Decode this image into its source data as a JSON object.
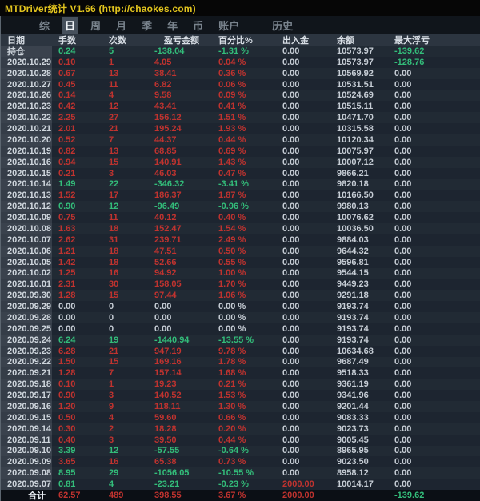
{
  "window": {
    "title": "MTDriver统计 V1.66 (http://chaokes.com)"
  },
  "tabs": [
    {
      "id": "zong",
      "label": "综",
      "active": false,
      "gap": false
    },
    {
      "id": "ri",
      "label": "日",
      "active": true,
      "gap": false
    },
    {
      "id": "zhou",
      "label": "周",
      "active": false,
      "gap": false
    },
    {
      "id": "yue",
      "label": "月",
      "active": false,
      "gap": false
    },
    {
      "id": "ji",
      "label": "季",
      "active": false,
      "gap": false
    },
    {
      "id": "nian",
      "label": "年",
      "active": false,
      "gap": false
    },
    {
      "id": "bi",
      "label": "币",
      "active": false,
      "gap": false
    },
    {
      "id": "zhanghu",
      "label": "账户",
      "active": false,
      "gap": false
    },
    {
      "id": "lishi",
      "label": "历史",
      "active": false,
      "gap": true
    }
  ],
  "colors": {
    "title_yellow": "#e2c41e",
    "profit_red": "#c0332f",
    "loss_green": "#33bd7a",
    "neutral_gray": "#c6cdd5",
    "date_column_bg": "#3a424d",
    "table_bg": "#1f2731"
  },
  "table": {
    "headers": [
      "日期",
      "手数",
      "次数",
      "盈亏金额",
      "百分比%",
      "出入金",
      "余额",
      "最大浮亏"
    ],
    "rows": [
      {
        "date": "持仓",
        "lots": "0.24",
        "trades": "5",
        "pnl": "-138.04",
        "pct": "-1.31 %",
        "cash": "0.00",
        "balance": "10573.97",
        "maxdd": "-139.62",
        "tone": "green",
        "cash_tone": "neutral",
        "maxdd_tone": "green",
        "total": false
      },
      {
        "date": "2020.10.29",
        "lots": "0.10",
        "trades": "1",
        "pnl": "4.05",
        "pct": "0.04 %",
        "cash": "0.00",
        "balance": "10573.97",
        "maxdd": "-128.76",
        "tone": "red",
        "cash_tone": "neutral",
        "maxdd_tone": "green",
        "total": false
      },
      {
        "date": "2020.10.28",
        "lots": "0.67",
        "trades": "13",
        "pnl": "38.41",
        "pct": "0.36 %",
        "cash": "0.00",
        "balance": "10569.92",
        "maxdd": "0.00",
        "tone": "red",
        "cash_tone": "neutral",
        "maxdd_tone": "neutral",
        "total": false
      },
      {
        "date": "2020.10.27",
        "lots": "0.45",
        "trades": "11",
        "pnl": "6.82",
        "pct": "0.06 %",
        "cash": "0.00",
        "balance": "10531.51",
        "maxdd": "0.00",
        "tone": "red",
        "cash_tone": "neutral",
        "maxdd_tone": "neutral",
        "total": false
      },
      {
        "date": "2020.10.26",
        "lots": "0.14",
        "trades": "4",
        "pnl": "9.58",
        "pct": "0.09 %",
        "cash": "0.00",
        "balance": "10524.69",
        "maxdd": "0.00",
        "tone": "red",
        "cash_tone": "neutral",
        "maxdd_tone": "neutral",
        "total": false
      },
      {
        "date": "2020.10.23",
        "lots": "0.42",
        "trades": "12",
        "pnl": "43.41",
        "pct": "0.41 %",
        "cash": "0.00",
        "balance": "10515.11",
        "maxdd": "0.00",
        "tone": "red",
        "cash_tone": "neutral",
        "maxdd_tone": "neutral",
        "total": false
      },
      {
        "date": "2020.10.22",
        "lots": "2.25",
        "trades": "27",
        "pnl": "156.12",
        "pct": "1.51 %",
        "cash": "0.00",
        "balance": "10471.70",
        "maxdd": "0.00",
        "tone": "red",
        "cash_tone": "neutral",
        "maxdd_tone": "neutral",
        "total": false
      },
      {
        "date": "2020.10.21",
        "lots": "2.01",
        "trades": "21",
        "pnl": "195.24",
        "pct": "1.93 %",
        "cash": "0.00",
        "balance": "10315.58",
        "maxdd": "0.00",
        "tone": "red",
        "cash_tone": "neutral",
        "maxdd_tone": "neutral",
        "total": false
      },
      {
        "date": "2020.10.20",
        "lots": "0.52",
        "trades": "7",
        "pnl": "44.37",
        "pct": "0.44 %",
        "cash": "0.00",
        "balance": "10120.34",
        "maxdd": "0.00",
        "tone": "red",
        "cash_tone": "neutral",
        "maxdd_tone": "neutral",
        "total": false
      },
      {
        "date": "2020.10.19",
        "lots": "0.82",
        "trades": "13",
        "pnl": "68.85",
        "pct": "0.69 %",
        "cash": "0.00",
        "balance": "10075.97",
        "maxdd": "0.00",
        "tone": "red",
        "cash_tone": "neutral",
        "maxdd_tone": "neutral",
        "total": false
      },
      {
        "date": "2020.10.16",
        "lots": "0.94",
        "trades": "15",
        "pnl": "140.91",
        "pct": "1.43 %",
        "cash": "0.00",
        "balance": "10007.12",
        "maxdd": "0.00",
        "tone": "red",
        "cash_tone": "neutral",
        "maxdd_tone": "neutral",
        "total": false
      },
      {
        "date": "2020.10.15",
        "lots": "0.21",
        "trades": "3",
        "pnl": "46.03",
        "pct": "0.47 %",
        "cash": "0.00",
        "balance": "9866.21",
        "maxdd": "0.00",
        "tone": "red",
        "cash_tone": "neutral",
        "maxdd_tone": "neutral",
        "total": false
      },
      {
        "date": "2020.10.14",
        "lots": "1.49",
        "trades": "22",
        "pnl": "-346.32",
        "pct": "-3.41 %",
        "cash": "0.00",
        "balance": "9820.18",
        "maxdd": "0.00",
        "tone": "green",
        "cash_tone": "neutral",
        "maxdd_tone": "neutral",
        "total": false
      },
      {
        "date": "2020.10.13",
        "lots": "1.52",
        "trades": "17",
        "pnl": "186.37",
        "pct": "1.87 %",
        "cash": "0.00",
        "balance": "10166.50",
        "maxdd": "0.00",
        "tone": "red",
        "cash_tone": "neutral",
        "maxdd_tone": "neutral",
        "total": false
      },
      {
        "date": "2020.10.12",
        "lots": "0.90",
        "trades": "12",
        "pnl": "-96.49",
        "pct": "-0.96 %",
        "cash": "0.00",
        "balance": "9980.13",
        "maxdd": "0.00",
        "tone": "green",
        "cash_tone": "neutral",
        "maxdd_tone": "neutral",
        "total": false
      },
      {
        "date": "2020.10.09",
        "lots": "0.75",
        "trades": "11",
        "pnl": "40.12",
        "pct": "0.40 %",
        "cash": "0.00",
        "balance": "10076.62",
        "maxdd": "0.00",
        "tone": "red",
        "cash_tone": "neutral",
        "maxdd_tone": "neutral",
        "total": false
      },
      {
        "date": "2020.10.08",
        "lots": "1.63",
        "trades": "18",
        "pnl": "152.47",
        "pct": "1.54 %",
        "cash": "0.00",
        "balance": "10036.50",
        "maxdd": "0.00",
        "tone": "red",
        "cash_tone": "neutral",
        "maxdd_tone": "neutral",
        "total": false
      },
      {
        "date": "2020.10.07",
        "lots": "2.62",
        "trades": "31",
        "pnl": "239.71",
        "pct": "2.49 %",
        "cash": "0.00",
        "balance": "9884.03",
        "maxdd": "0.00",
        "tone": "red",
        "cash_tone": "neutral",
        "maxdd_tone": "neutral",
        "total": false
      },
      {
        "date": "2020.10.06",
        "lots": "1.21",
        "trades": "18",
        "pnl": "47.51",
        "pct": "0.50 %",
        "cash": "0.00",
        "balance": "9644.32",
        "maxdd": "0.00",
        "tone": "red",
        "cash_tone": "neutral",
        "maxdd_tone": "neutral",
        "total": false
      },
      {
        "date": "2020.10.05",
        "lots": "1.42",
        "trades": "18",
        "pnl": "52.66",
        "pct": "0.55 %",
        "cash": "0.00",
        "balance": "9596.81",
        "maxdd": "0.00",
        "tone": "red",
        "cash_tone": "neutral",
        "maxdd_tone": "neutral",
        "total": false
      },
      {
        "date": "2020.10.02",
        "lots": "1.25",
        "trades": "16",
        "pnl": "94.92",
        "pct": "1.00 %",
        "cash": "0.00",
        "balance": "9544.15",
        "maxdd": "0.00",
        "tone": "red",
        "cash_tone": "neutral",
        "maxdd_tone": "neutral",
        "total": false
      },
      {
        "date": "2020.10.01",
        "lots": "2.31",
        "trades": "30",
        "pnl": "158.05",
        "pct": "1.70 %",
        "cash": "0.00",
        "balance": "9449.23",
        "maxdd": "0.00",
        "tone": "red",
        "cash_tone": "neutral",
        "maxdd_tone": "neutral",
        "total": false
      },
      {
        "date": "2020.09.30",
        "lots": "1.28",
        "trades": "15",
        "pnl": "97.44",
        "pct": "1.06 %",
        "cash": "0.00",
        "balance": "9291.18",
        "maxdd": "0.00",
        "tone": "red",
        "cash_tone": "neutral",
        "maxdd_tone": "neutral",
        "total": false
      },
      {
        "date": "2020.09.29",
        "lots": "0.00",
        "trades": "0",
        "pnl": "0.00",
        "pct": "0.00 %",
        "cash": "0.00",
        "balance": "9193.74",
        "maxdd": "0.00",
        "tone": "neutral",
        "cash_tone": "neutral",
        "maxdd_tone": "neutral",
        "total": false
      },
      {
        "date": "2020.09.28",
        "lots": "0.00",
        "trades": "0",
        "pnl": "0.00",
        "pct": "0.00 %",
        "cash": "0.00",
        "balance": "9193.74",
        "maxdd": "0.00",
        "tone": "neutral",
        "cash_tone": "neutral",
        "maxdd_tone": "neutral",
        "total": false
      },
      {
        "date": "2020.09.25",
        "lots": "0.00",
        "trades": "0",
        "pnl": "0.00",
        "pct": "0.00 %",
        "cash": "0.00",
        "balance": "9193.74",
        "maxdd": "0.00",
        "tone": "neutral",
        "cash_tone": "neutral",
        "maxdd_tone": "neutral",
        "total": false
      },
      {
        "date": "2020.09.24",
        "lots": "6.24",
        "trades": "19",
        "pnl": "-1440.94",
        "pct": "-13.55 %",
        "cash": "0.00",
        "balance": "9193.74",
        "maxdd": "0.00",
        "tone": "green",
        "cash_tone": "neutral",
        "maxdd_tone": "neutral",
        "total": false
      },
      {
        "date": "2020.09.23",
        "lots": "6.28",
        "trades": "21",
        "pnl": "947.19",
        "pct": "9.78 %",
        "cash": "0.00",
        "balance": "10634.68",
        "maxdd": "0.00",
        "tone": "red",
        "cash_tone": "neutral",
        "maxdd_tone": "neutral",
        "total": false
      },
      {
        "date": "2020.09.22",
        "lots": "1.50",
        "trades": "15",
        "pnl": "169.16",
        "pct": "1.78 %",
        "cash": "0.00",
        "balance": "9687.49",
        "maxdd": "0.00",
        "tone": "red",
        "cash_tone": "neutral",
        "maxdd_tone": "neutral",
        "total": false
      },
      {
        "date": "2020.09.21",
        "lots": "1.28",
        "trades": "7",
        "pnl": "157.14",
        "pct": "1.68 %",
        "cash": "0.00",
        "balance": "9518.33",
        "maxdd": "0.00",
        "tone": "red",
        "cash_tone": "neutral",
        "maxdd_tone": "neutral",
        "total": false
      },
      {
        "date": "2020.09.18",
        "lots": "0.10",
        "trades": "1",
        "pnl": "19.23",
        "pct": "0.21 %",
        "cash": "0.00",
        "balance": "9361.19",
        "maxdd": "0.00",
        "tone": "red",
        "cash_tone": "neutral",
        "maxdd_tone": "neutral",
        "total": false
      },
      {
        "date": "2020.09.17",
        "lots": "0.90",
        "trades": "3",
        "pnl": "140.52",
        "pct": "1.53 %",
        "cash": "0.00",
        "balance": "9341.96",
        "maxdd": "0.00",
        "tone": "red",
        "cash_tone": "neutral",
        "maxdd_tone": "neutral",
        "total": false
      },
      {
        "date": "2020.09.16",
        "lots": "1.20",
        "trades": "9",
        "pnl": "118.11",
        "pct": "1.30 %",
        "cash": "0.00",
        "balance": "9201.44",
        "maxdd": "0.00",
        "tone": "red",
        "cash_tone": "neutral",
        "maxdd_tone": "neutral",
        "total": false
      },
      {
        "date": "2020.09.15",
        "lots": "0.50",
        "trades": "4",
        "pnl": "59.60",
        "pct": "0.66 %",
        "cash": "0.00",
        "balance": "9083.33",
        "maxdd": "0.00",
        "tone": "red",
        "cash_tone": "neutral",
        "maxdd_tone": "neutral",
        "total": false
      },
      {
        "date": "2020.09.14",
        "lots": "0.30",
        "trades": "2",
        "pnl": "18.28",
        "pct": "0.20 %",
        "cash": "0.00",
        "balance": "9023.73",
        "maxdd": "0.00",
        "tone": "red",
        "cash_tone": "neutral",
        "maxdd_tone": "neutral",
        "total": false
      },
      {
        "date": "2020.09.11",
        "lots": "0.40",
        "trades": "3",
        "pnl": "39.50",
        "pct": "0.44 %",
        "cash": "0.00",
        "balance": "9005.45",
        "maxdd": "0.00",
        "tone": "red",
        "cash_tone": "neutral",
        "maxdd_tone": "neutral",
        "total": false
      },
      {
        "date": "2020.09.10",
        "lots": "3.39",
        "trades": "12",
        "pnl": "-57.55",
        "pct": "-0.64 %",
        "cash": "0.00",
        "balance": "8965.95",
        "maxdd": "0.00",
        "tone": "green",
        "cash_tone": "neutral",
        "maxdd_tone": "neutral",
        "total": false
      },
      {
        "date": "2020.09.09",
        "lots": "3.65",
        "trades": "16",
        "pnl": "65.38",
        "pct": "0.73 %",
        "cash": "0.00",
        "balance": "9023.50",
        "maxdd": "0.00",
        "tone": "red",
        "cash_tone": "neutral",
        "maxdd_tone": "neutral",
        "total": false
      },
      {
        "date": "2020.09.08",
        "lots": "8.95",
        "trades": "29",
        "pnl": "-1056.05",
        "pct": "-10.55 %",
        "cash": "0.00",
        "balance": "8958.12",
        "maxdd": "0.00",
        "tone": "green",
        "cash_tone": "neutral",
        "maxdd_tone": "neutral",
        "total": false
      },
      {
        "date": "2020.09.07",
        "lots": "0.81",
        "trades": "4",
        "pnl": "-23.21",
        "pct": "-0.23 %",
        "cash": "2000.00",
        "balance": "10014.17",
        "maxdd": "0.00",
        "tone": "green",
        "cash_tone": "red",
        "maxdd_tone": "neutral",
        "total": false
      },
      {
        "date": "合计",
        "lots": "62.57",
        "trades": "489",
        "pnl": "398.55",
        "pct": "3.67 %",
        "cash": "2000.00",
        "balance": "",
        "maxdd": "-139.62",
        "tone": "red",
        "cash_tone": "red",
        "maxdd_tone": "green",
        "total": true
      }
    ]
  }
}
